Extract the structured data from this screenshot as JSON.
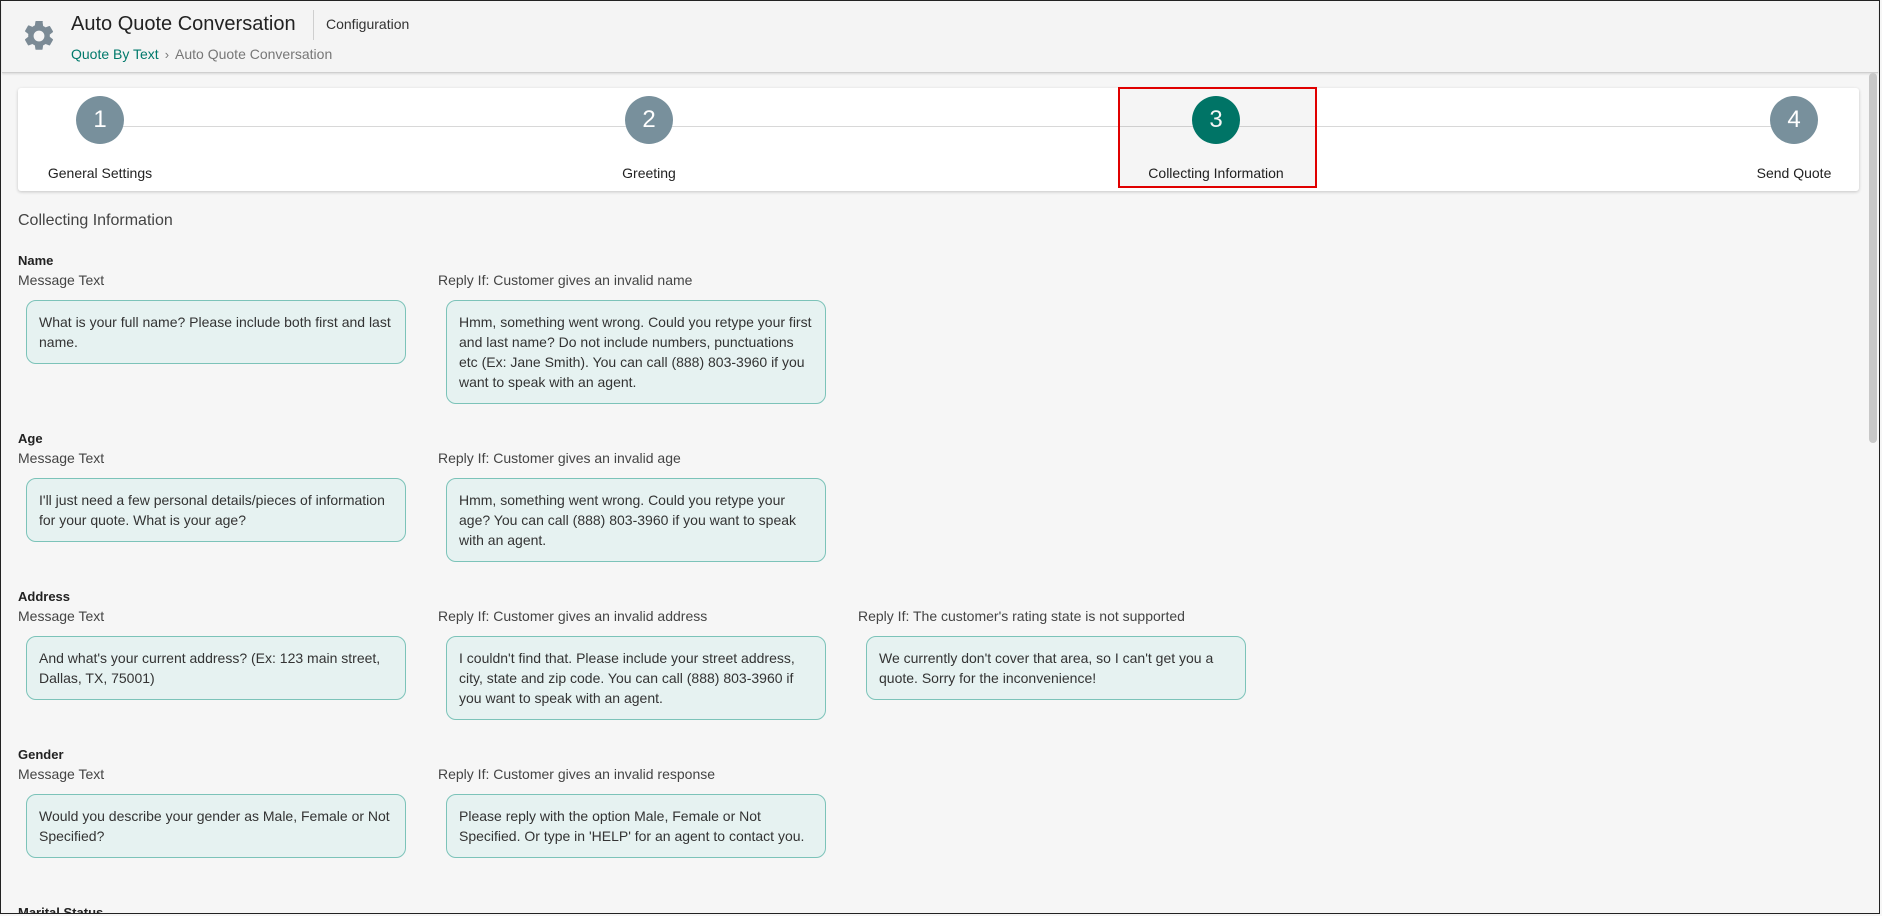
{
  "header": {
    "title": "Auto Quote Conversation",
    "subtitle": "Configuration",
    "breadcrumb": {
      "parent": "Quote By Text",
      "separator": "›",
      "current": "Auto Quote Conversation"
    },
    "icon": "gear-icon"
  },
  "stepper": {
    "steps": [
      {
        "number": "1",
        "label": "General Settings",
        "active": false
      },
      {
        "number": "2",
        "label": "Greeting",
        "active": false
      },
      {
        "number": "3",
        "label": "Collecting Information",
        "active": true
      },
      {
        "number": "4",
        "label": "Send Quote",
        "active": false
      }
    ],
    "colors": {
      "inactive": "#78909c",
      "active": "#00796b",
      "highlight": "#e00000"
    }
  },
  "content": {
    "section_title": "Collecting Information",
    "groups": [
      {
        "name": "Name",
        "message_label": "Message Text",
        "message": "What is your full name? Please include both first and last name.",
        "replies": [
          {
            "label": "Reply If: Customer gives an invalid name",
            "text": "Hmm, something went wrong. Could you retype your first and last name? Do not include numbers, punctuations etc (Ex: Jane Smith). You can call (888) 803-3960 if you want to speak with an agent."
          }
        ]
      },
      {
        "name": "Age",
        "message_label": "Message Text",
        "message": "I'll just need a few personal details/pieces of information for your quote. What is your age?",
        "replies": [
          {
            "label": "Reply If: Customer gives an invalid age",
            "text": "Hmm, something went wrong. Could you retype your age? You can call (888) 803-3960 if you want to speak with an agent."
          }
        ]
      },
      {
        "name": "Address",
        "message_label": "Message Text",
        "message": "And what's your current address? (Ex: 123 main street, Dallas, TX, 75001)",
        "replies": [
          {
            "label": "Reply If: Customer gives an invalid address",
            "text": "I couldn't find that. Please include your street address, city, state and zip code. You can call (888) 803-3960 if you want to speak with an agent."
          },
          {
            "label": "Reply If: The customer's rating state is not supported",
            "text": "We currently don't cover that area, so I can't get you a quote. Sorry for the inconvenience!"
          }
        ]
      },
      {
        "name": "Gender",
        "message_label": "Message Text",
        "message": "Would you describe your gender as Male, Female or Not Specified?",
        "replies": [
          {
            "label": "Reply If: Customer gives an invalid response",
            "text": "Please reply with the option Male, Female or Not Specified. Or type in 'HELP' for an agent to contact you."
          }
        ]
      }
    ],
    "next_group_name": "Marital Status"
  }
}
